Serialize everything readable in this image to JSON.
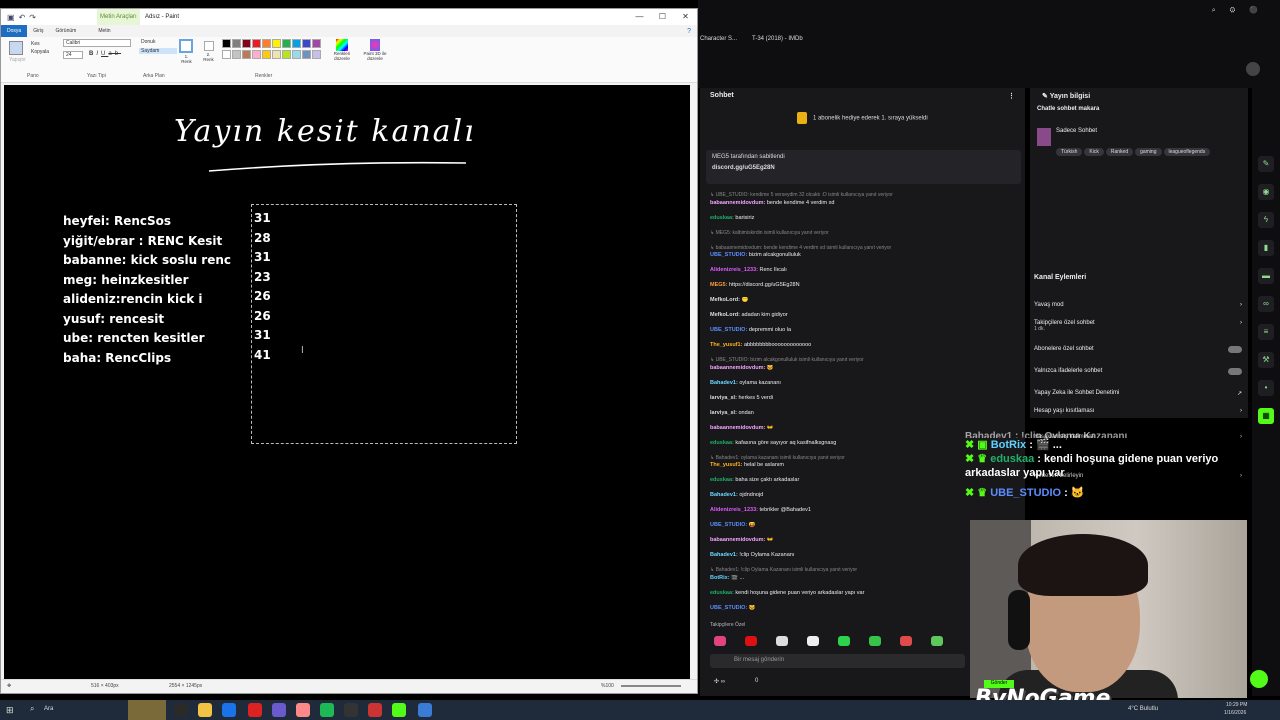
{
  "paint": {
    "ctx_tab": "Metin Araçları",
    "title": "Adsız - Paint",
    "tabs": [
      "Dosya",
      "Giriş",
      "Görünüm",
      "Metin"
    ],
    "groups": [
      "Pano",
      "Yazı Tipi",
      "Arka Plan",
      "Renkler"
    ],
    "clipboard": {
      "paste": "Yapıştır",
      "cut": "Kes",
      "copy": "Kopyala"
    },
    "font": {
      "name": "Calibri",
      "size": "24"
    },
    "background": {
      "opaque": "Donuk",
      "transparent": "Saydam"
    },
    "color1": "1. Renk",
    "color2": "2. Renk",
    "edit_colors": "Renkleri düzenle",
    "paint3d": "Paint 3D ile düzenle",
    "status_pos": "516 × 403px",
    "status_size": "2554 × 1245px",
    "zoom": "%100",
    "palette": [
      "#000000",
      "#7f7f7f",
      "#880015",
      "#ed1c24",
      "#ff7f27",
      "#fff200",
      "#22b14c",
      "#00a2e8",
      "#3f48cc",
      "#a349a4",
      "#ffffff",
      "#c3c3c3",
      "#b97a57",
      "#ffaec9",
      "#ffc90e",
      "#efe4b0",
      "#b5e61d",
      "#99d9ea",
      "#7092be",
      "#c8bfe7"
    ]
  },
  "canvas": {
    "handwritten_title": "Yayın kesit kanalı",
    "list": [
      "heyfei: RencSos",
      "yiğit/ebrar : RENC Kesit",
      "babanne: kick soslu renc",
      "meg: heinzkesitler",
      "alideniz:rencin kick i",
      "yusuf: rencesit",
      "ube: rencten kesitler",
      "baha: RencClips"
    ],
    "numbers": [
      "31",
      "28",
      "31",
      "23",
      "26",
      "26",
      "31",
      "41"
    ]
  },
  "browser": {
    "tab1": "Character S...",
    "tab2": "T-34 (2018) - IMDb"
  },
  "chat": {
    "title": "Sohbet",
    "sub_banner": "1 abonelik hediye ederek 1. sıraya yükseldi",
    "pinned_by": "MEG5 tarafından sabitlendi",
    "pinned_link": "discord.gg/uG5Eg28N",
    "messages": [
      {
        "reply": "↳ UBE_STUDIO: kendime 5 verseydim 32 olcaktı :D isimli kullanıcıya yanıt veriyor",
        "nick": "babaannemidovdum:",
        "color": "#f3a7ff",
        "text": "bende kendime 4 verdim xd"
      },
      {
        "nick": "eduskaa:",
        "color": "#1fb06b",
        "text": "barisiriz"
      },
      {
        "reply": "↳ MEG5: kalbimiskirdin isimli kullanıcıya yanıt veriyor",
        "nick": "",
        "color": "#999",
        "text": ""
      },
      {
        "reply": "↳ babaannemidovdum: bende kendime 4 verdim xd isimli kullanıcıya yanıt veriyor",
        "nick": "UBE_STUDIO:",
        "color": "#5c8dff",
        "text": "bizim alcakgonulluluk"
      },
      {
        "nick": "Alidenizreis_1233:",
        "color": "#e05cff",
        "text": "Renc İlıcalı"
      },
      {
        "nick": "MEG5:",
        "color": "#ff9c3d",
        "text": "https://discord.gg/uG5Eg28N"
      },
      {
        "nick": "MefkoLord:",
        "color": "#dddddd",
        "text": "😶"
      },
      {
        "nick": "MefkoLord:",
        "color": "#dddddd",
        "text": "adadan kim gidiyor"
      },
      {
        "nick": "UBE_STUDIO:",
        "color": "#5c8dff",
        "text": "depremmi oluo la"
      },
      {
        "nick": "The_yusuf1:",
        "color": "#ffb31a",
        "text": "abbbbbbbbooooooooooooo"
      },
      {
        "reply": "↳ UBE_STUDIO: bizim alcakgonulluluk isimli kullanıcıya yanıt veriyor",
        "nick": "babaannemidovdum:",
        "color": "#f3a7ff",
        "text": "🐱"
      },
      {
        "nick": "Bahadev1:",
        "color": "#6bd7ff",
        "text": "oylama kazananı"
      },
      {
        "nick": "larviya_sl:",
        "color": "#dddddd",
        "text": "herkes 5 verdi"
      },
      {
        "nick": "larviya_sl:",
        "color": "#dddddd",
        "text": "ondan"
      },
      {
        "nick": "babaannemidovdum:",
        "color": "#f3a7ff",
        "text": "👐"
      },
      {
        "nick": "eduskaa:",
        "color": "#1fb06b",
        "text": "kafasına göre sayıyor aq kasifnalksgnasg"
      },
      {
        "reply": "↳ Bahadev1: oylama kazananı isimli kullanıcıya yanıt veriyor",
        "nick": "The_yusuf1:",
        "color": "#ffb31a",
        "text": "helal be aslanım"
      },
      {
        "nick": "eduskaa:",
        "color": "#1fb06b",
        "text": "baha size çaktı arkadaslar"
      },
      {
        "nick": "Bahadev1:",
        "color": "#6bd7ff",
        "text": "ojdndnojd"
      },
      {
        "nick": "Alidenizreis_1233:",
        "color": "#e05cff",
        "text": "tebrikler @Bahadev1"
      },
      {
        "nick": "UBE_STUDIO:",
        "color": "#5c8dff",
        "text": "😝"
      },
      {
        "nick": "babaannemidovdum:",
        "color": "#f3a7ff",
        "text": "👐"
      },
      {
        "nick": "Bahadev1:",
        "color": "#6bd7ff",
        "text": "!clip Oylama Kazananı"
      },
      {
        "reply": "↳ Bahadev1: !clip Oylama Kazananı isimli kullanıcıya yanıt veriyor",
        "nick": "BotRix:",
        "color": "#5fd3ff",
        "text": "🎬 ..."
      },
      {
        "nick": "eduskaa:",
        "color": "#1fb06b",
        "text": "kendi hoşuna gidene puan veriyo arkadaslar yapı var"
      },
      {
        "nick": "UBE_STUDIO:",
        "color": "#5c8dff",
        "text": "🐱"
      }
    ],
    "followers_only": "Takipçilere Özel",
    "input_placeholder": "Bir mesaj gönderin",
    "footer_count": "0",
    "send": "Gönder"
  },
  "info": {
    "title": "Yayın bilgisi",
    "chattle": "Chatle sohbet makara",
    "category": "Sadece Sohbet",
    "tags": [
      "Türkish",
      "Kick",
      "Ranked",
      "gaming",
      "leagueoflegends"
    ],
    "channel_actions": "Kanal Eylemleri",
    "menu": [
      {
        "label": "Yavaş mod",
        "type": "arrow"
      },
      {
        "label": "Takipçilere özel sohbet",
        "sub": "1 dk.",
        "type": "arrow"
      },
      {
        "label": "Abonelere özel sohbet",
        "type": "toggle"
      },
      {
        "label": "Yalnızca ifadelerle sohbet",
        "type": "toggle"
      },
      {
        "label": "Yapay Zeka ile Sohbet Denetimi",
        "type": "link"
      },
      {
        "label": "Hesap yaşı kısıtlaması",
        "type": "arrow"
      },
      {
        "label": "Yasaklanmış kelimeler",
        "type": "arrow"
      },
      {
        "label": "Hedefleri belirleyin",
        "type": "arrow"
      }
    ]
  },
  "overlay": {
    "line0": "Bahadev1 : !clip Oylama Kazananı",
    "line1_nick": "BotRix",
    "line1_text": ": 🎬 ...",
    "line2_nick": "eduskaa",
    "line2_text": ": kendi hoşuna gidene puan veriyo arkadaslar yapı var",
    "line3_nick": "UBE_STUDIO",
    "line3_text": ": 🐱"
  },
  "watermark": "ByNoGame",
  "taskbar": {
    "search": "Ara",
    "weather": "4°C Bulutlu",
    "time": "10:29 PM",
    "date": "1/16/2026"
  }
}
